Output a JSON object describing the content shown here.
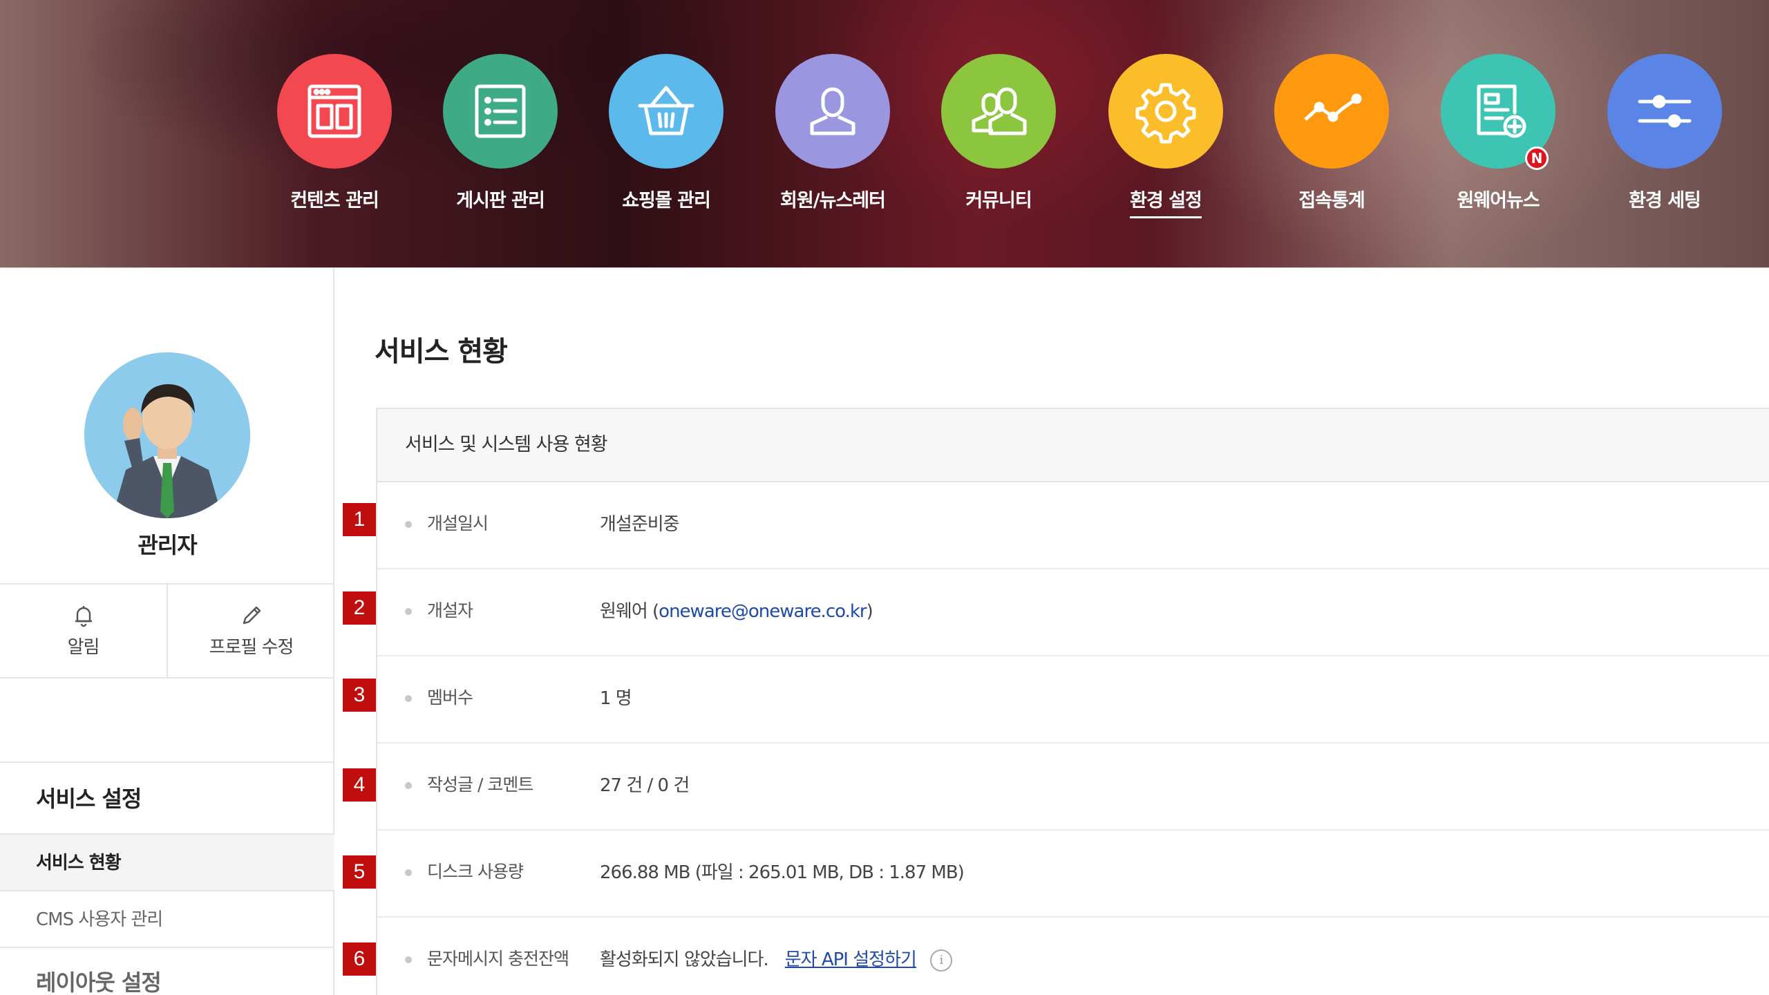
{
  "nav": {
    "items": [
      {
        "label": "컨텐츠 관리",
        "color": "#f3484f",
        "icon": "content-layout-icon"
      },
      {
        "label": "게시판 관리",
        "color": "#3faa86",
        "icon": "board-list-icon"
      },
      {
        "label": "쇼핑몰 관리",
        "color": "#5bb9ec",
        "icon": "shopping-basket-icon"
      },
      {
        "label": "회원/뉴스레터",
        "color": "#9a97e0",
        "icon": "member-user-icon"
      },
      {
        "label": "커뮤니티",
        "color": "#8cc63f",
        "icon": "community-users-icon"
      },
      {
        "label": "환경 설정",
        "color": "#fbbd2a",
        "icon": "gear-icon",
        "active": true
      },
      {
        "label": "접속통계",
        "color": "#ff9a10",
        "icon": "stats-line-icon"
      },
      {
        "label": "원웨어뉴스",
        "color": "#3ec4b2",
        "icon": "news-document-icon",
        "badge": "N"
      },
      {
        "label": "환경 세팅",
        "color": "#5a85e6",
        "icon": "sliders-icon"
      }
    ]
  },
  "sidebar": {
    "profile_name": "관리자",
    "quick": [
      {
        "label": "알림",
        "icon": "bell-icon"
      },
      {
        "label": "프로필 수정",
        "icon": "pencil-icon"
      }
    ],
    "section_title": "서비스 설정",
    "links": [
      {
        "label": "서비스 현황",
        "active": true
      },
      {
        "label": "CMS 사용자 관리"
      }
    ],
    "next_section_title": "레이아웃 설정"
  },
  "main": {
    "title": "서비스 현황",
    "panel_title": "서비스 및 시스템 사용 현황",
    "rows": [
      {
        "num": "1",
        "label": "개설일시",
        "value": "개설준비중"
      },
      {
        "num": "2",
        "label": "개설자",
        "value_prefix": "원웨어 (",
        "email": "oneware@oneware.co.kr",
        "value_suffix": ")"
      },
      {
        "num": "3",
        "label": "멤버수",
        "value": "1 명"
      },
      {
        "num": "4",
        "label": "작성글 / 코멘트",
        "value": "27 건 / 0 건"
      },
      {
        "num": "5",
        "label": "디스크 사용량",
        "value": "266.88 MB (파일 : 265.01 MB, DB : 1.87 MB)"
      },
      {
        "num": "6",
        "label": "문자메시지 충전잔액",
        "value": "활성화되지 않았습니다.",
        "link": "문자 API 설정하기",
        "info": "i"
      }
    ]
  }
}
